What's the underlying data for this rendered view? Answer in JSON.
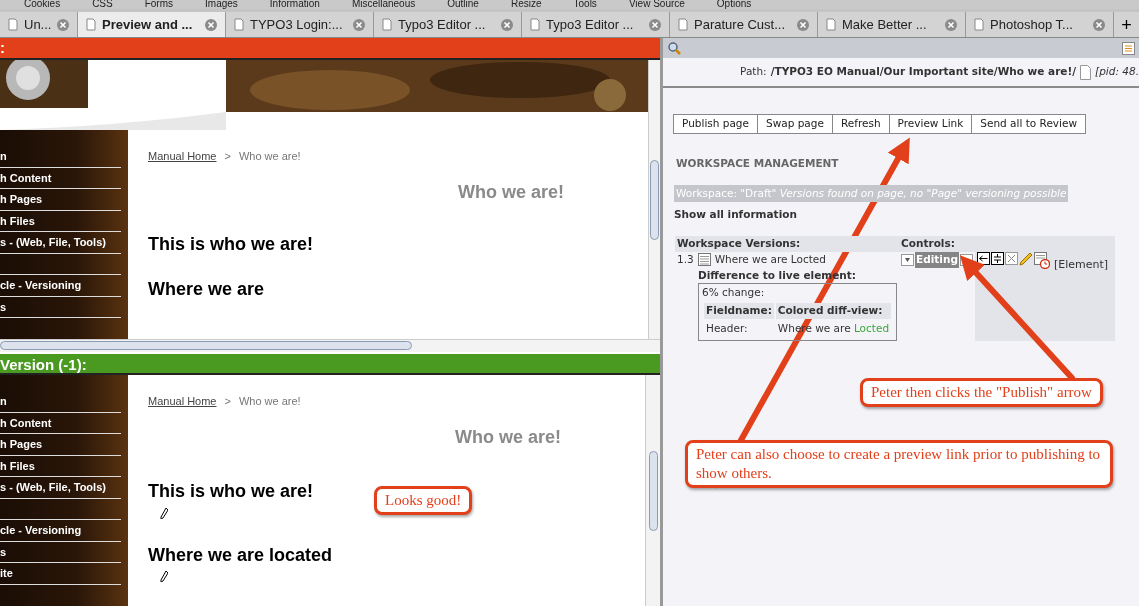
{
  "browser": {
    "menu_items": [
      "Cookies",
      "CSS",
      "Forms",
      "Images",
      "Information",
      "Miscellaneous",
      "Outline",
      "Resize",
      "Tools",
      "View Source",
      "Options"
    ],
    "tabs": [
      {
        "label": "Un...",
        "selected": false
      },
      {
        "label": "Preview and ...",
        "selected": true
      },
      {
        "label": "TYPO3 Login:...",
        "selected": false
      },
      {
        "label": "Typo3 Editor ...",
        "selected": false
      },
      {
        "label": "Typo3 Editor ...",
        "selected": false
      },
      {
        "label": "Parature Cust...",
        "selected": false
      },
      {
        "label": "Make Better ...",
        "selected": false
      },
      {
        "label": "Photoshop T...",
        "selected": false
      }
    ],
    "new_tab": "+"
  },
  "live_frame": {
    "title": ":",
    "nav_items": [
      {
        "label": "n",
        "gap_before": false
      },
      {
        "label": "h Content",
        "gap_before": false
      },
      {
        "label": "h Pages",
        "gap_before": false
      },
      {
        "label": "h Files",
        "gap_before": false
      },
      {
        "label": "s - (Web, File, Tools)",
        "gap_before": false
      },
      {
        "label": "cle - Versioning",
        "gap_before": true
      },
      {
        "label": "s",
        "gap_before": false
      }
    ],
    "breadcrumb": {
      "link": "Manual Home",
      "separator": ">",
      "current": "Who we are!"
    },
    "page_title": "Who we are!",
    "headings": [
      {
        "text": "This is who we are!",
        "editable": false
      },
      {
        "text": "Where we are",
        "editable": false
      }
    ]
  },
  "version_frame": {
    "title": "Version (-1):",
    "nav_items": [
      {
        "label": "n",
        "gap_before": false
      },
      {
        "label": "h Content",
        "gap_before": false
      },
      {
        "label": "h Pages",
        "gap_before": false
      },
      {
        "label": "h Files",
        "gap_before": false
      },
      {
        "label": "s - (Web, File, Tools)",
        "gap_before": false
      },
      {
        "label": "cle - Versioning",
        "gap_before": true
      },
      {
        "label": "s",
        "gap_before": false
      },
      {
        "label": "ite",
        "gap_before": false
      }
    ],
    "breadcrumb": {
      "link": "Manual Home",
      "separator": ">",
      "current": "Who we are!"
    },
    "page_title": "Who we are!",
    "headings": [
      {
        "text": "This is who we are!",
        "editable": true
      },
      {
        "text": "Where we are located",
        "editable": true
      }
    ]
  },
  "workspace_panel": {
    "path_label": "Path:",
    "path": "/TYPO3 EO Manual/Our Important site/Who we are!/",
    "pid": "[pid: 48.",
    "buttons": [
      "Publish page",
      "Swap page",
      "Refresh",
      "Preview Link",
      "Send all to Review"
    ],
    "section_title": "WORKSPACE MANAGEMENT",
    "notice": "Workspace: \"Draft\" *Versions found on page, no \"Page\" versioning possible*",
    "show_all": "Show all information",
    "versions_header": "Workspace Versions:",
    "controls_header": "Controls:",
    "version": {
      "number": "1.3",
      "title": "Where we are Locted",
      "diff_title": "Difference to live element:",
      "change": "6% change:",
      "diff_columns": [
        "Fieldname:",
        "Colored diff-view:"
      ],
      "diff_rows": [
        {
          "field": "Header:",
          "unchanged": "Where we are",
          "inserted": "Locted"
        }
      ]
    },
    "stage": "Editing",
    "element_label": "[Element]"
  },
  "annotations": [
    {
      "text": "Looks good!"
    },
    {
      "text": "Peter then clicks the \"Publish\" arrow"
    },
    {
      "text": "Peter can also choose to create a preview link prior to publishing to show others."
    }
  ]
}
